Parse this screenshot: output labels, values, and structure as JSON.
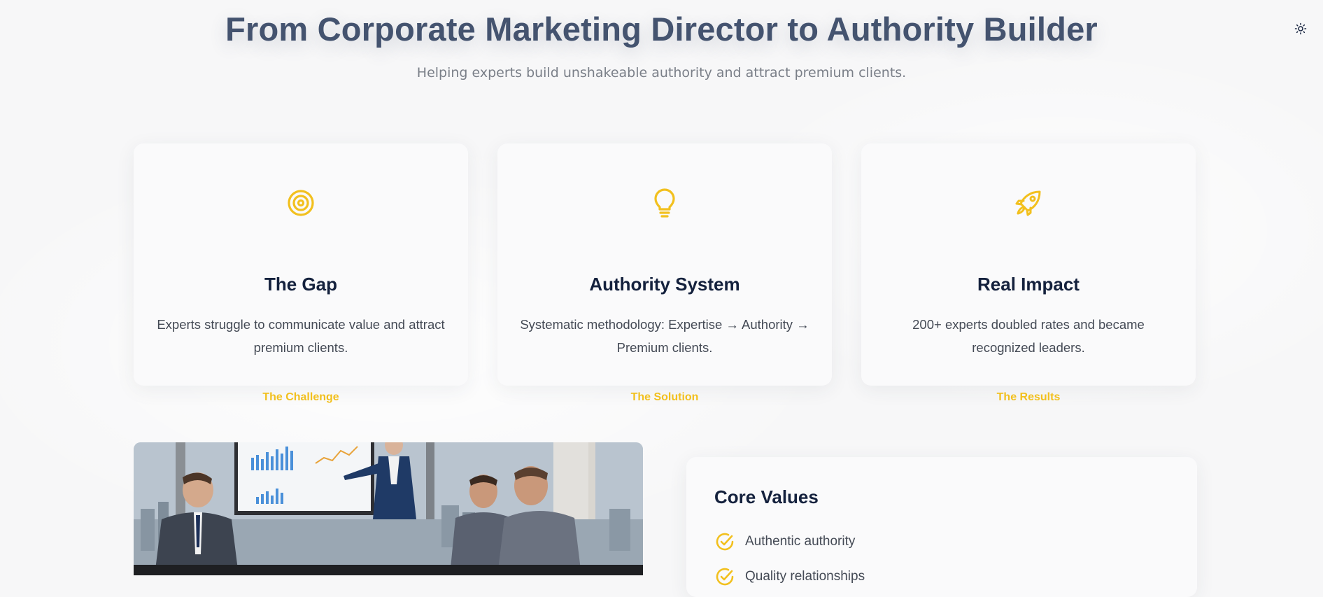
{
  "header": {
    "title": "From Corporate Marketing Director to Authority Builder",
    "subtitle": "Helping experts build unshakeable authority and attract premium clients."
  },
  "theme_toggle": {
    "icon": "sun-icon"
  },
  "colors": {
    "accent": "#f2c01e",
    "title": "#44536f",
    "heading": "#14213d",
    "body_text": "#444a55",
    "background": "#f7f7f8"
  },
  "cards": [
    {
      "icon": "target-icon",
      "eyebrow": "The Challenge",
      "title": "The Gap",
      "description": "Experts struggle to communicate value and attract premium clients."
    },
    {
      "icon": "lightbulb-icon",
      "eyebrow": "The Solution",
      "title": "Authority System",
      "description": "Systematic methodology: Expertise → Authority → Premium clients."
    },
    {
      "icon": "rocket-icon",
      "eyebrow": "The Results",
      "title": "Real Impact",
      "description": "200+ experts doubled rates and became recognized leaders."
    }
  ],
  "core_values": {
    "title": "Core Values",
    "items": [
      "Authentic authority",
      "Quality relationships"
    ]
  }
}
